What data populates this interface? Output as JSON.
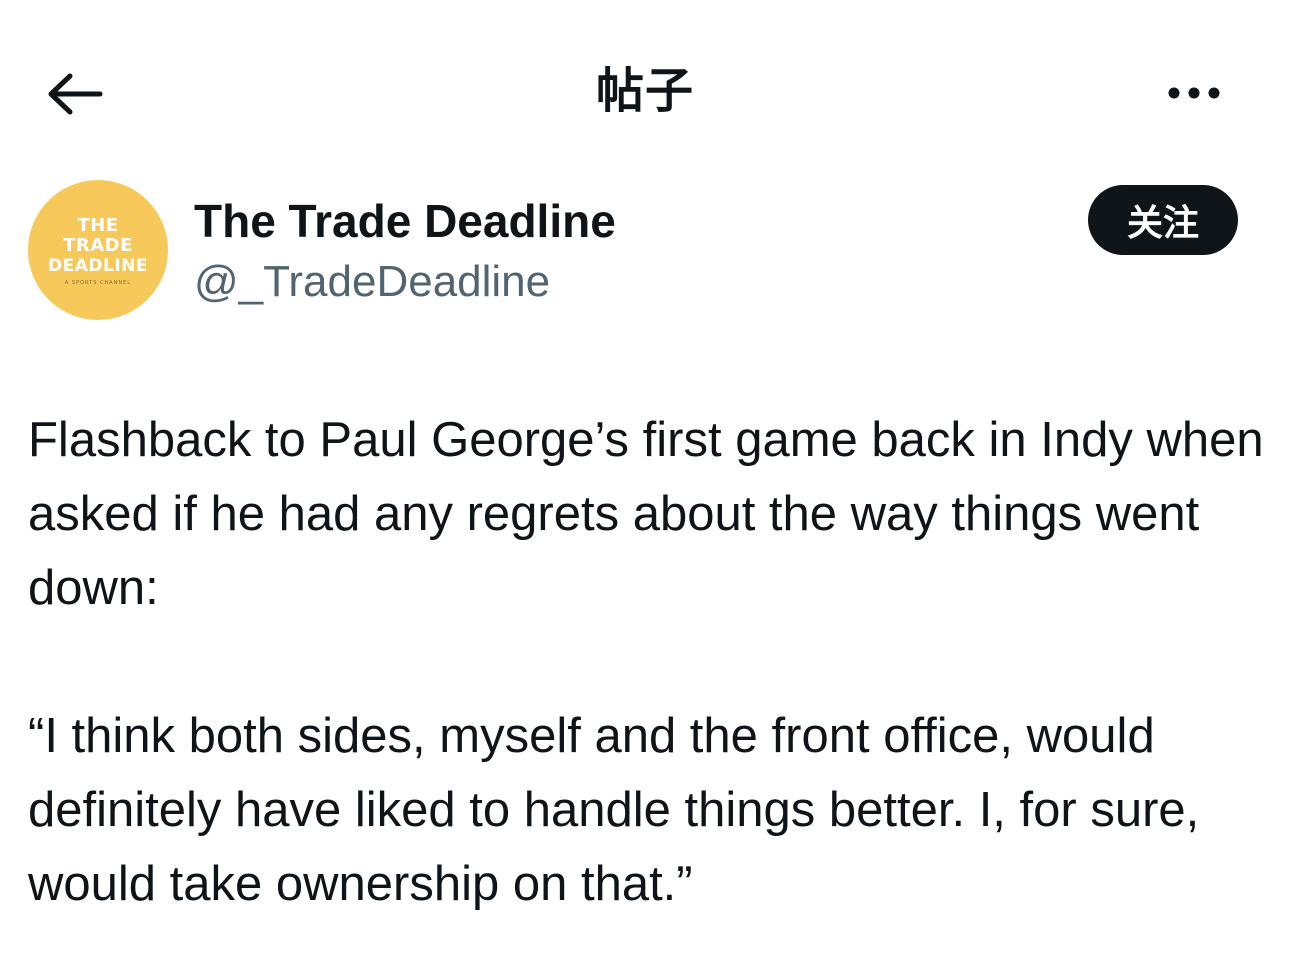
{
  "header": {
    "title": "帖子",
    "back_icon": "arrow-left-icon",
    "more_icon": "more-horizontal-icon"
  },
  "author": {
    "avatar_lines": [
      "THE",
      "TRADE",
      "DEADLINE"
    ],
    "avatar_subtitle": "A SPORTS CHANNEL",
    "avatar_color": "#f7c85a",
    "display_name": "The Trade Deadline",
    "handle": "@_TradeDeadline",
    "follow_label": "关注"
  },
  "post": {
    "paragraphs": [
      "Flashback to Paul George’s first game back in Indy when asked if he had any regrets about the way things went down:",
      "“I think both sides, myself and the front office, would definitely have liked to handle things better. I, for sure, would take ownership on that.”"
    ]
  },
  "colors": {
    "text": "#0f1419",
    "secondary_text": "#536471",
    "button_bg": "#0f1419"
  }
}
